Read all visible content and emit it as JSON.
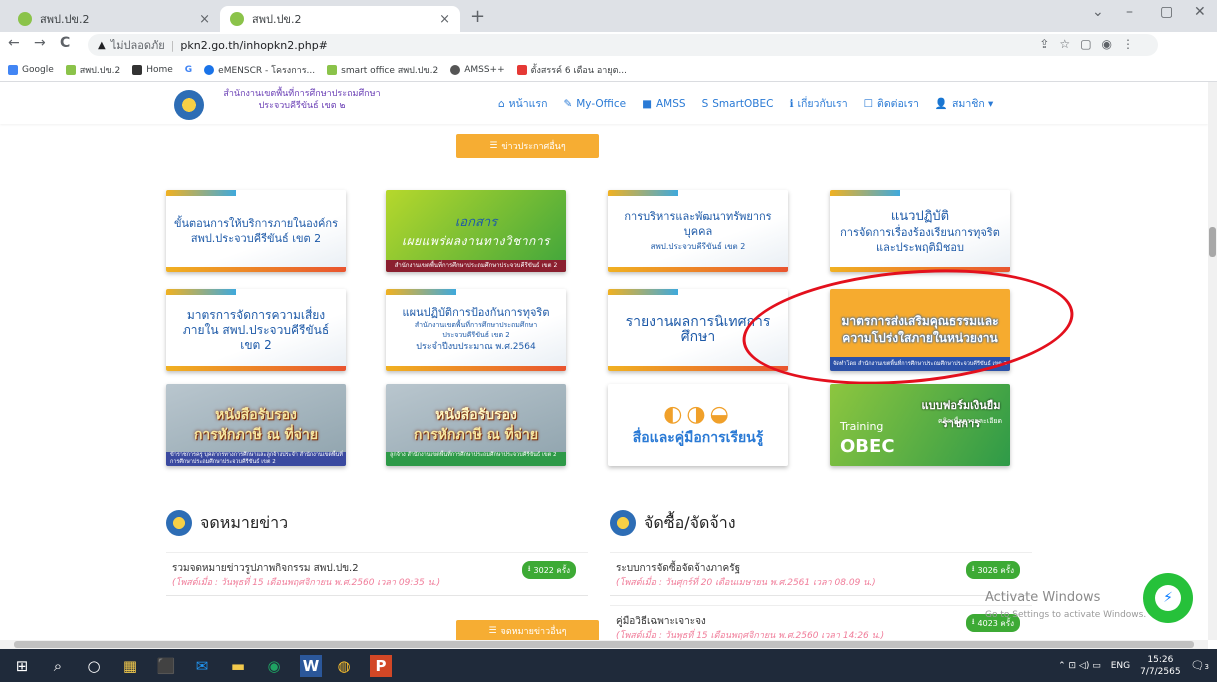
{
  "browser": {
    "tabs": [
      {
        "title": "สพป.ปข.2",
        "close": "×"
      },
      {
        "title": "สพป.ปข.2",
        "close": "×"
      }
    ],
    "new_tab": "+",
    "window_controls": {
      "chevron": "⌄",
      "minimize": "–",
      "restore": "▢",
      "close": "✕"
    },
    "nav": {
      "back": "←",
      "forward": "→",
      "reload": "C"
    },
    "address": {
      "security_icon": "▲",
      "security": "ไม่ปลอดภัย",
      "separator": "|",
      "url": "pkn2.go.th/inhopkn2.php#",
      "icons": "⇪☆▢◉⋮"
    },
    "bookmarks": [
      {
        "label": "Google",
        "color": "#4285f4"
      },
      {
        "label": "สพป.ปข.2",
        "color": "#8bc34a"
      },
      {
        "label": "Home",
        "color": "#333333"
      },
      {
        "label": "G",
        "color": "#4285f4"
      },
      {
        "label": "eMENSCR - โครงการ...",
        "color": "#1a73e8"
      },
      {
        "label": "smart office สพป.ปข.2",
        "color": "#8bc34a"
      },
      {
        "label": "AMSS++",
        "color": "#555555"
      },
      {
        "label": "ตั้งสรรค์ 6 เดือน อายุต...",
        "color": "#e53935"
      }
    ]
  },
  "site": {
    "name_line1": "สำนักงานเขตพื้นที่การศึกษาประถมศึกษา",
    "name_line2": "ประจวบคีรีขันธ์ เขต ๒",
    "menu": [
      {
        "icon": "⌂",
        "label": "หน้าแรก"
      },
      {
        "icon": "✎",
        "label": "My-Office"
      },
      {
        "icon": "■",
        "label": "AMSS"
      },
      {
        "icon": "S",
        "label": "SmartOBEC"
      },
      {
        "icon": "ℹ",
        "label": "เกี่ยวกับเรา"
      },
      {
        "icon": "☐",
        "label": "ติดต่อเรา"
      },
      {
        "icon": "👤",
        "label": "สมาชิก ▾"
      }
    ],
    "news_button": "ข่าวประกาศอื่นๆ",
    "cards": {
      "c1": "ขั้นตอนการให้บริการภายในองค์กร สพป.ประจวบคีรีขันธ์ เขต 2",
      "c2_line1": "เอกสาร",
      "c2_line2": "เผยแพร่ผลงานทางวิชาการ",
      "c2_foot": "สำนักงานเขตพื้นที่การศึกษาประถมศึกษาประจวบคีรีขันธ์ เขต 2",
      "c3_line1": "การบริหารและพัฒนาทรัพยากรบุคคล",
      "c3_line2": "สพป.ประจวบคีรีขันธ์ เขต 2",
      "c4_line1": "แนวปฏิบัติ",
      "c4_line2": "การจัดการเรื่องร้องเรียนการทุจริต",
      "c4_line3": "และประพฤติมิชอบ",
      "c5": "มาตรการจัดการความเสี่ยงภายใน สพป.ประจวบคีรีขันธ์ เขต 2",
      "c6_line1": "แผนปฏิบัติการป้องกันการทุจริต",
      "c6_line2": "สำนักงานเขตพื้นที่การศึกษาประถมศึกษาประจวบคีรีขันธ์ เขต 2",
      "c6_line3": "ประจำปีงบประมาณ พ.ศ.2564",
      "c7": "รายงานผลการนิเทศการศึกษา",
      "c8_line1": "มาตรการส่งเสริมคุณธรรมและ",
      "c8_line2": "ความโปร่งใสภายในหน่วยงาน",
      "c8_foot": "จัดทำโดย สำนักงานเขตพื้นที่การศึกษาประถมศึกษาประจวบคีรีขันธ์ เขต 2",
      "c9_line1": "หนังสือรับรอง",
      "c9_line2": "การหักภาษี ณ ที่จ่าย",
      "c9_foot": "ข้าราชการครู บุคลากรทางการศึกษาและลูกจ้างประจำ สำนักงานเขตพื้นที่การศึกษาประถมศึกษาประจวบคีรีขันธ์ เขต 2",
      "c10_line1": "หนังสือรับรอง",
      "c10_line2": "การหักภาษี ณ ที่จ่าย",
      "c10_foot": "ลูกจ้าง สำนักงานเขตพื้นที่การศึกษาประถมศึกษาประจวบคีรีขันธ์ เขต 2",
      "c11": "สื่อและคู่มือการเรียนรู้",
      "c12_title": "แบบฟอร์มเงินยืมราชการ",
      "c12_sub": "คลิกเพื่อดูรายละเอียด",
      "c12_training": "Training",
      "c12_obec": "OBEC"
    },
    "news": {
      "title": "จดหมายข่าว",
      "items": [
        {
          "name": "รวมจดหมายข่าวรูปภาพกิจกรรม สพป.ปข.2",
          "date": "(โพสต์เมื่อ : วันพุธที่ 15 เดือนพฤศจิกายน พ.ศ.2560 เวลา 09:35 น.)",
          "count": "3022 ครั้ง"
        }
      ],
      "more_button": "จดหมายข่าวอื่นๆ"
    },
    "procure": {
      "title": "จัดซื้อ/จัดจ้าง",
      "items": [
        {
          "name": "ระบบการจัดซื้อจัดจ้างภาครัฐ",
          "date": "(โพสต์เมื่อ : วันศุกร์ที่ 20 เดือนเมษายน พ.ศ.2561 เวลา 08.09 น.)",
          "count": "3026 ครั้ง"
        },
        {
          "name": "คู่มือวิธีเฉพาะเจาะจง",
          "date": "(โพสต์เมื่อ : วันพุธที่ 15 เดือนพฤศจิกายน พ.ศ.2560 เวลา 14:26 น.)",
          "count": "4023 ครั้ง"
        }
      ]
    }
  },
  "watermark": {
    "line1": "Activate Windows",
    "line2": "Go to Settings to activate Windows."
  },
  "taskbar": {
    "start": "⊞",
    "search": "⌕",
    "apps": [
      "○",
      "▦",
      "⬛",
      "✉",
      "▬",
      "◉",
      "W",
      "◍",
      "P"
    ],
    "tray_icons": "⌃ ⊡ ◁) ▭",
    "lang": "ENG",
    "time": "15:26",
    "date": "7/7/2565",
    "notif": "3"
  }
}
